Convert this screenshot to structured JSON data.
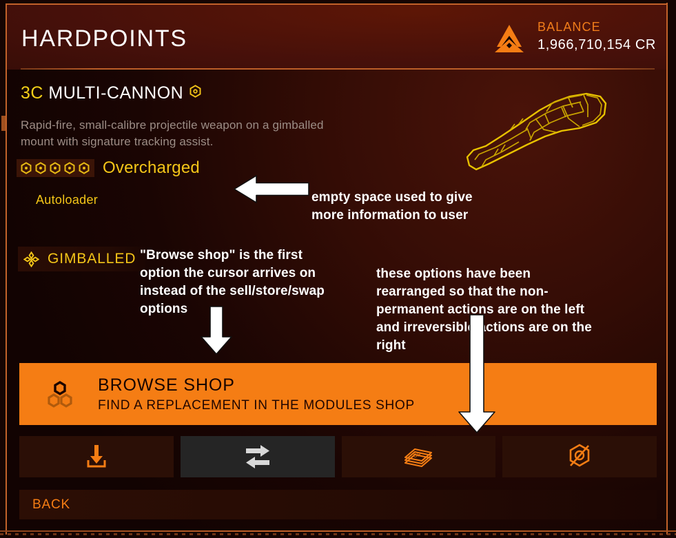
{
  "header": {
    "title": "HARDPOINTS",
    "balance_label": "BALANCE",
    "balance_value": "1,966,710,154 CR",
    "balance_icon": "federation-credit-icon"
  },
  "module": {
    "class_rating": "3C",
    "name": "MULTI-CANNON",
    "title_icon": "hexagon-module-icon",
    "description": "Rapid-fire, small-calibre projectile weapon on a gimballed mount with signature tracking assist.",
    "engineering": {
      "blueprint": "Overcharged",
      "grade_pips": 5,
      "pip_icon": "hexagon-pip-icon",
      "experimental_effect": "Autoloader"
    },
    "mount": {
      "label": "GIMBALLED",
      "icon": "gimbal-crosshair-icon"
    },
    "art_icon": "multi-cannon-wireframe"
  },
  "primary_action": {
    "title": "BROWSE SHOP",
    "subtitle": "FIND A REPLACEMENT IN THE MODULES SHOP",
    "icon": "modules-hexagon-cluster-icon",
    "selected": false
  },
  "actions": [
    {
      "name": "store",
      "icon": "download-tray-icon",
      "state": "enabled",
      "selected": false
    },
    {
      "name": "swap",
      "icon": "swap-arrows-icon",
      "state": "selected",
      "selected": true
    },
    {
      "name": "sell",
      "icon": "credit-notes-icon",
      "state": "enabled",
      "selected": false
    },
    {
      "name": "discard",
      "icon": "hexagon-slashed-icon",
      "state": "enabled",
      "selected": false
    }
  ],
  "back": {
    "label": "BACK"
  },
  "annotations": [
    {
      "id": "empty-space",
      "text": "empty space used to give\nmore information to user",
      "arrow": "arrow-left"
    },
    {
      "id": "browse-shop-first",
      "text": "\"Browse shop\" is the first\noption the cursor arrives on\ninstead of the sell/store/swap\noptions",
      "arrow": "arrow-down"
    },
    {
      "id": "rearranged-options",
      "text": "these options have been\nrearranged so that the non-\npermanent actions are on the left\nand irreversible actions are on the\nright",
      "arrow": "arrow-down"
    }
  ],
  "colors": {
    "accent_orange": "#f57d14",
    "engineer_yellow": "#f4c518",
    "text_white": "#ffffff",
    "description_grey": "#9c8d86",
    "panel_dark": "#2b0f06",
    "selected_grey": "#252525",
    "frame_orange": "#c2622a"
  }
}
